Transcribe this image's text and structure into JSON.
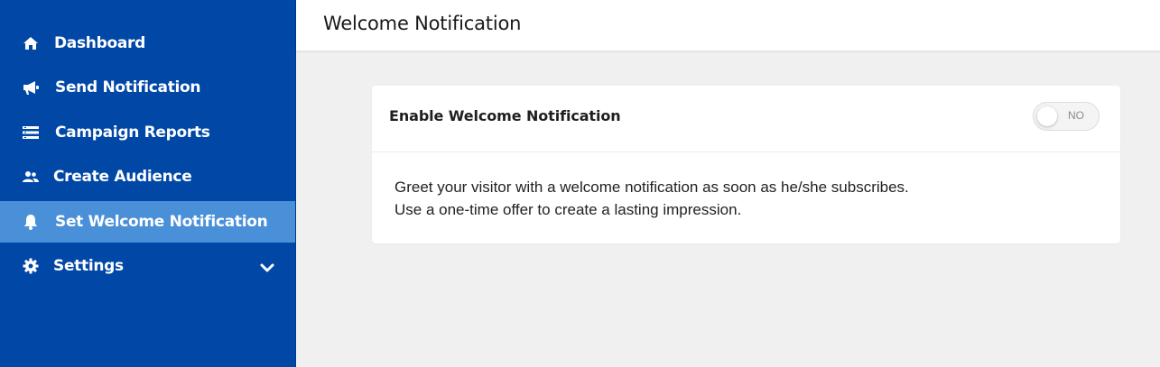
{
  "colors": {
    "sidebar_bg": "#0047a6",
    "sidebar_active_bg": "#4a90d9",
    "content_bg": "#f0f0f0",
    "card_bg": "#ffffff",
    "text_primary": "#1f1f1f"
  },
  "sidebar": {
    "items": [
      {
        "label": "Dashboard",
        "icon": "home-icon",
        "active": false
      },
      {
        "label": "Send Notification",
        "icon": "megaphone-icon",
        "active": false
      },
      {
        "label": "Campaign Reports",
        "icon": "report-list-icon",
        "active": false
      },
      {
        "label": "Create Audience",
        "icon": "users-icon",
        "active": false
      },
      {
        "label": "Set Welcome Notification",
        "icon": "bell-icon",
        "active": true
      },
      {
        "label": "Settings",
        "icon": "gear-icon",
        "active": false,
        "has_submenu": true,
        "submenu_icon": "chevron-down-icon"
      }
    ]
  },
  "header": {
    "title": "Welcome Notification"
  },
  "card": {
    "title": "Enable Welcome Notification",
    "toggle": {
      "state_label": "NO",
      "enabled": false
    },
    "description_lines": [
      "Greet your visitor with a welcome notification as soon as he/she subscribes.",
      "Use a one-time offer to create a lasting impression."
    ]
  }
}
